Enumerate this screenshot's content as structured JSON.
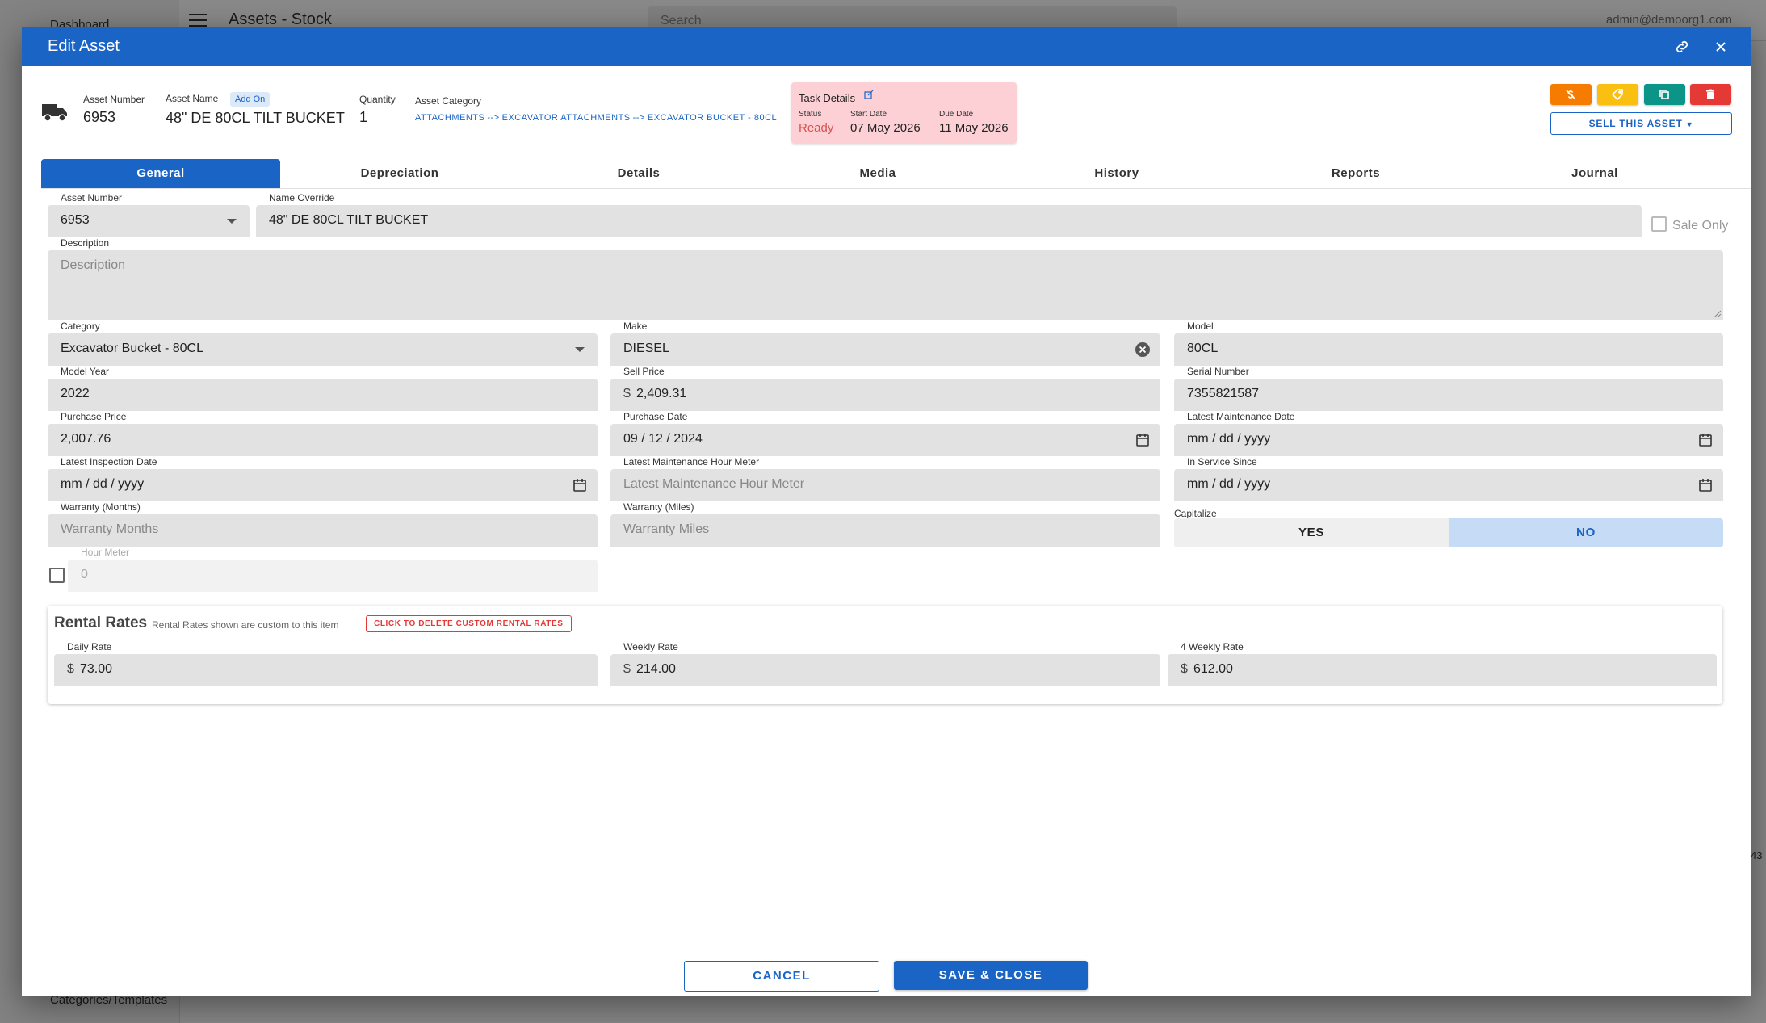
{
  "background": {
    "sidebar_top_item": "Dashboard",
    "sidebar_bottom_item": "Categories/Templates",
    "page_title": "Assets - Stock",
    "search_placeholder": "Search",
    "user_email": "admin@demoorg1.com",
    "right_edge_number": "43"
  },
  "dialog": {
    "title": "Edit Asset",
    "header_color": "#1a64c6"
  },
  "info": {
    "asset_number_label": "Asset Number",
    "asset_number": "6953",
    "asset_name_label": "Asset Name",
    "addon_badge": "Add On",
    "asset_name": "48\" DE 80CL TILT BUCKET",
    "quantity_label": "Quantity",
    "quantity": "1",
    "category_label": "Asset Category",
    "breadcrumb": [
      "ATTACHMENTS",
      "EXCAVATOR ATTACHMENTS",
      "EXCAVATOR BUCKET - 80CL"
    ],
    "breadcrumb_sep_1": "-->",
    "breadcrumb_sep_2": "-->"
  },
  "task": {
    "title": "Task Details",
    "status_label": "Status",
    "status": "Ready",
    "start_label": "Start Date",
    "start": "07 May 2026",
    "due_label": "Due Date",
    "due": "11 May 2026",
    "bg_color": "#fcd0d4",
    "status_color": "#d9534f"
  },
  "actions": {
    "colors": [
      "#f57c00",
      "#f9c012",
      "#0d9488",
      "#e53935"
    ],
    "icons": [
      "money-off-icon",
      "tag-icon",
      "copy-icon",
      "trash-icon"
    ],
    "sell_label": "SELL THIS ASSET"
  },
  "tabs": [
    "General",
    "Depreciation",
    "Details",
    "Media",
    "History",
    "Reports",
    "Journal"
  ],
  "active_tab": "General",
  "fields": {
    "asset_number": {
      "label": "Asset Number",
      "value": "6953"
    },
    "name_override": {
      "label": "Name Override",
      "value": "48\" DE 80CL TILT BUCKET"
    },
    "sale_only": "Sale Only",
    "description": {
      "label": "Description",
      "placeholder": "Description"
    },
    "category": {
      "label": "Category",
      "value": "Excavator Bucket - 80CL"
    },
    "make": {
      "label": "Make",
      "value": "DIESEL"
    },
    "model": {
      "label": "Model",
      "value": "80CL"
    },
    "model_year": {
      "label": "Model Year",
      "value": "2022"
    },
    "sell_price": {
      "label": "Sell Price",
      "currency": "$",
      "value": "2,409.31"
    },
    "serial_number": {
      "label": "Serial Number",
      "value": "7355821587"
    },
    "purchase_price": {
      "label": "Purchase Price",
      "value": "2,007.76"
    },
    "purchase_date": {
      "label": "Purchase Date",
      "value": "09 / 12 / 2024"
    },
    "latest_maintenance_date": {
      "label": "Latest Maintenance Date",
      "value": "mm / dd / yyyy"
    },
    "latest_inspection_date": {
      "label": "Latest Inspection Date",
      "value": "mm / dd / yyyy"
    },
    "latest_maintenance_hour_meter": {
      "label": "Latest Maintenance Hour Meter",
      "placeholder": "Latest Maintenance Hour Meter"
    },
    "in_service_since": {
      "label": "In Service Since",
      "value": "mm / dd / yyyy"
    },
    "warranty_months": {
      "label": "Warranty (Months)",
      "placeholder": "Warranty Months"
    },
    "warranty_miles": {
      "label": "Warranty (Miles)",
      "placeholder": "Warranty Miles"
    },
    "capitalize": {
      "label": "Capitalize",
      "yes": "YES",
      "no": "NO",
      "selected": "NO"
    },
    "hour_meter": {
      "label": "Hour Meter",
      "value": "0"
    }
  },
  "rental": {
    "title": "Rental Rates",
    "subtitle": "Rental Rates shown are custom to this item",
    "delete_button": "CLICK TO DELETE CUSTOM RENTAL RATES",
    "daily": {
      "label": "Daily Rate",
      "currency": "$",
      "value": "73.00"
    },
    "weekly": {
      "label": "Weekly Rate",
      "currency": "$",
      "value": "214.00"
    },
    "four_weekly": {
      "label": "4 Weekly Rate",
      "currency": "$",
      "value": "612.00"
    }
  },
  "footer": {
    "cancel": "CANCEL",
    "save": "SAVE & CLOSE"
  }
}
